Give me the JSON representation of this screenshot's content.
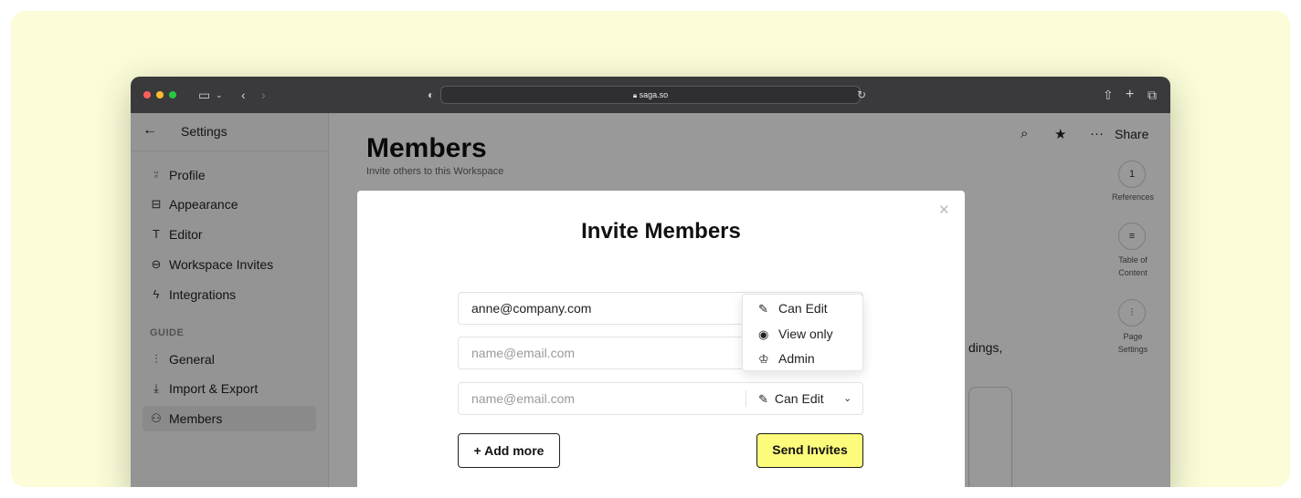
{
  "browser": {
    "url": "saga.so",
    "traffic_lights": [
      "#ff5f57",
      "#febc2e",
      "#28c840"
    ]
  },
  "sidebar": {
    "back_icon": "arrow-left-icon",
    "title": "Settings",
    "items": [
      {
        "label": "Profile",
        "icon": "person-icon",
        "glyph": "⍤"
      },
      {
        "label": "Appearance",
        "icon": "layout-icon",
        "glyph": "⊟"
      },
      {
        "label": "Editor",
        "icon": "text-icon",
        "glyph": "T"
      },
      {
        "label": "Workspace Invites",
        "icon": "inbox-icon",
        "glyph": "⊖"
      },
      {
        "label": "Integrations",
        "icon": "bolt-icon",
        "glyph": "ϟ"
      }
    ],
    "section_label": "GUIDE",
    "guide_items": [
      {
        "label": "General",
        "icon": "sliders-icon",
        "glyph": "⫶"
      },
      {
        "label": "Import & Export",
        "icon": "download-icon",
        "glyph": "⤓"
      },
      {
        "label": "Members",
        "icon": "users-icon",
        "glyph": "⚇",
        "active": true
      }
    ]
  },
  "main": {
    "title": "Members",
    "subtitle": "Invite others to this Workspace",
    "background_text": "dings,"
  },
  "right_rail": {
    "share_label": "Share",
    "references_count": "1",
    "references_label": "References",
    "toc_label_1": "Table of",
    "toc_label_2": "Content",
    "page_settings_label_1": "Page",
    "page_settings_label_2": "Settings"
  },
  "modal": {
    "title": "Invite Members",
    "close_icon": "close-icon",
    "rows": [
      {
        "email": "anne@company.com",
        "role": "Can Edit"
      },
      {
        "placeholder": "name@email.com",
        "role": "Can Edit"
      },
      {
        "placeholder": "name@email.com",
        "role": "Can Edit"
      }
    ],
    "dropdown_options": [
      {
        "label": "Can Edit",
        "icon": "pencil-icon"
      },
      {
        "label": "View only",
        "icon": "eye-icon"
      },
      {
        "label": "Admin",
        "icon": "crown-icon"
      }
    ],
    "add_more_label": "+ Add more",
    "send_label": "Send Invites",
    "send_color": "#fcfb7c"
  },
  "colors": {
    "backdrop": "#fcfdd8",
    "titlebar": "#3a3a3c"
  }
}
